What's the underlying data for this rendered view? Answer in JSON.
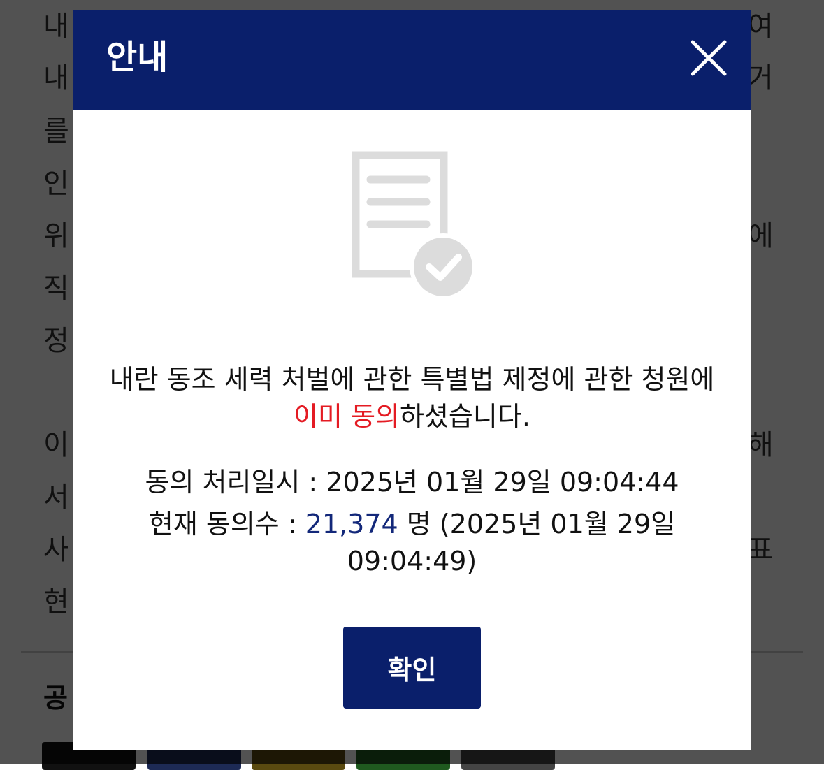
{
  "background": {
    "left_fragments": [
      "내",
      "내",
      "를",
      "인",
      "위",
      "직",
      "정",
      "이",
      "서",
      "사",
      "현"
    ],
    "right_fragments": [
      "여",
      "거",
      "",
      "",
      "에",
      "",
      "",
      "해",
      "",
      "표",
      ""
    ],
    "section_title": "공",
    "thumb_colors": [
      "#111111",
      "#1d2a55",
      "#5a4a10",
      "#1f5a1f",
      "#444444"
    ]
  },
  "modal": {
    "title": "안내",
    "close_icon": "close-icon",
    "document_icon": "document-check-icon",
    "message_prefix": "내란 동조 세력 처벌에 관한 특별법 제정에 관한 청원에 ",
    "message_highlight": "이미 동의",
    "message_suffix": "하셨습니다.",
    "consent_time_label": "동의 처리일시 : ",
    "consent_time_value": "2025년 01월 29일 09:04:44",
    "current_count_label": "현재 동의수 : ",
    "current_count_value": "21,374",
    "current_count_unit": " 명 ",
    "current_count_time": "(2025년 01월 29일 09:04:49)",
    "confirm_label": "확인",
    "colors": {
      "header": "#0a1f6b",
      "highlight_red": "#e41b23",
      "count_blue": "#13287a",
      "button": "#0a1f6b"
    }
  }
}
